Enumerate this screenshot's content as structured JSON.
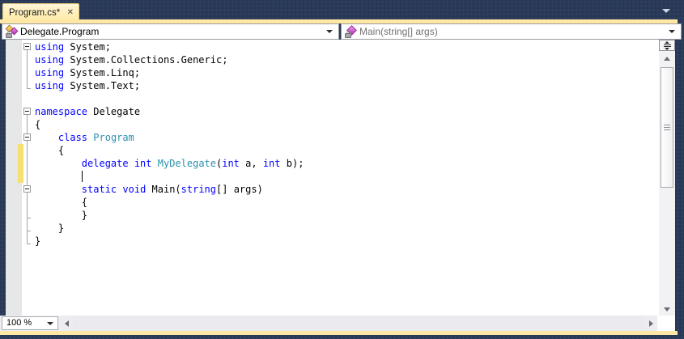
{
  "tab": {
    "title": "Program.cs*",
    "close_icon": "✕"
  },
  "navbar": {
    "type_dropdown": {
      "label": "Delegate.Program",
      "icon": "class-icon"
    },
    "member_dropdown": {
      "label": "Main(string[] args)",
      "icon": "method-private-icon"
    }
  },
  "editor": {
    "language": "C#",
    "lines": [
      {
        "tokens": [
          {
            "t": "using",
            "c": "k"
          },
          {
            "t": " System;",
            "c": "p"
          }
        ]
      },
      {
        "tokens": [
          {
            "t": "using",
            "c": "k"
          },
          {
            "t": " System.Collections.Generic;",
            "c": "p"
          }
        ]
      },
      {
        "tokens": [
          {
            "t": "using",
            "c": "k"
          },
          {
            "t": " System.Linq;",
            "c": "p"
          }
        ]
      },
      {
        "tokens": [
          {
            "t": "using",
            "c": "k"
          },
          {
            "t": " System.Text;",
            "c": "p"
          }
        ]
      },
      {
        "tokens": []
      },
      {
        "tokens": [
          {
            "t": "namespace",
            "c": "k"
          },
          {
            "t": " Delegate",
            "c": "p"
          }
        ]
      },
      {
        "tokens": [
          {
            "t": "{",
            "c": "p"
          }
        ]
      },
      {
        "tokens": [
          {
            "t": "    ",
            "c": "p"
          },
          {
            "t": "class",
            "c": "k"
          },
          {
            "t": " ",
            "c": "p"
          },
          {
            "t": "Program",
            "c": "t"
          }
        ]
      },
      {
        "tokens": [
          {
            "t": "    {",
            "c": "p"
          }
        ]
      },
      {
        "tokens": [
          {
            "t": "        ",
            "c": "p"
          },
          {
            "t": "delegate",
            "c": "k"
          },
          {
            "t": " ",
            "c": "p"
          },
          {
            "t": "int",
            "c": "k"
          },
          {
            "t": " ",
            "c": "p"
          },
          {
            "t": "MyDelegate",
            "c": "t"
          },
          {
            "t": "(",
            "c": "p"
          },
          {
            "t": "int",
            "c": "k"
          },
          {
            "t": " a, ",
            "c": "p"
          },
          {
            "t": "int",
            "c": "k"
          },
          {
            "t": " b);",
            "c": "p"
          }
        ]
      },
      {
        "tokens": []
      },
      {
        "tokens": [
          {
            "t": "        ",
            "c": "p"
          },
          {
            "t": "static",
            "c": "k"
          },
          {
            "t": " ",
            "c": "p"
          },
          {
            "t": "void",
            "c": "k"
          },
          {
            "t": " Main(",
            "c": "p"
          },
          {
            "t": "string",
            "c": "k"
          },
          {
            "t": "[] args)",
            "c": "p"
          }
        ]
      },
      {
        "tokens": [
          {
            "t": "        {",
            "c": "p"
          }
        ]
      },
      {
        "tokens": [
          {
            "t": "        }",
            "c": "p"
          }
        ]
      },
      {
        "tokens": [
          {
            "t": "    }",
            "c": "p"
          }
        ]
      },
      {
        "tokens": [
          {
            "t": "}",
            "c": "p"
          }
        ]
      }
    ],
    "caret": {
      "line": 11,
      "col": 8
    },
    "changed_lines": {
      "from": 9,
      "to": 11
    },
    "outline_regions": [
      {
        "start": 1,
        "end": 4
      },
      {
        "start": 6,
        "end": 16
      },
      {
        "start": 8,
        "end": 15
      },
      {
        "start": 12,
        "end": 14
      }
    ]
  },
  "status_bar": {
    "zoom_value": "100 %"
  },
  "colors": {
    "window_background": "#293955",
    "active_tab_accent": "#ffe8a5",
    "keyword": "#0000ff",
    "type_name": "#2b91af",
    "plain_text": "#000000",
    "change_bar": "#f7e06f"
  }
}
